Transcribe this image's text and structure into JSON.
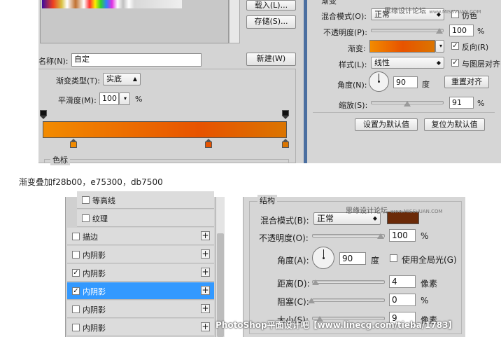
{
  "gradient_editor": {
    "load_btn": "载入(L)...",
    "save_btn": "存储(S)...",
    "name_label": "名称(N):",
    "name_value": "自定",
    "new_btn": "新建(W)",
    "type_label": "渐变类型(T):",
    "type_value": "实底",
    "smooth_label": "平滑度(M):",
    "smooth_value": "100",
    "smooth_unit": "%",
    "color_stops_label": "色标",
    "gradient_colors": [
      "#f28b00",
      "#e75300",
      "#db7500"
    ]
  },
  "gradient_overlay": {
    "section_label": "渐变",
    "blend_label": "混合模式(O):",
    "blend_value": "正常",
    "dither_label": "仿色",
    "opacity_label": "不透明度(P):",
    "opacity_value": "100",
    "opacity_unit": "%",
    "gradient_label": "渐变:",
    "reverse_label": "反向(R)",
    "style_label": "样式(L):",
    "style_value": "线性",
    "align_label": "与图层对齐",
    "angle_label": "角度(N):",
    "angle_value": "90",
    "angle_unit": "度",
    "reset_align_btn": "重置对齐",
    "scale_label": "缩放(S):",
    "scale_value": "91",
    "scale_unit": "%",
    "set_default_btn": "设置为默认值",
    "reset_default_btn": "复位为默认值",
    "watermark": "思缘设计论坛",
    "watermark_url": "www.MISSVUAN.COM"
  },
  "caption": "渐变叠加f28b00，e75300，db7500",
  "styles_list": {
    "items": [
      {
        "label": "等高线",
        "checked": false,
        "selected": false,
        "has_plus": false
      },
      {
        "label": "纹理",
        "checked": false,
        "selected": false,
        "has_plus": false
      },
      {
        "label": "描边",
        "checked": false,
        "selected": false,
        "has_plus": true
      },
      {
        "label": "内阴影",
        "checked": false,
        "selected": false,
        "has_plus": true
      },
      {
        "label": "内阴影",
        "checked": true,
        "selected": false,
        "has_plus": true
      },
      {
        "label": "内阴影",
        "checked": true,
        "selected": true,
        "has_plus": true
      },
      {
        "label": "内阴影",
        "checked": false,
        "selected": false,
        "has_plus": true
      },
      {
        "label": "内阴影",
        "checked": false,
        "selected": false,
        "has_plus": true
      }
    ]
  },
  "inner_shadow": {
    "section_label": "结构",
    "blend_label": "混合模式(B):",
    "blend_value": "正常",
    "color": "#6b2a08",
    "opacity_label": "不透明度(O):",
    "opacity_value": "100",
    "opacity_unit": "%",
    "angle_label": "角度(A):",
    "angle_value": "90",
    "angle_unit": "度",
    "global_light_label": "使用全局光(G)",
    "distance_label": "距离(D):",
    "distance_value": "4",
    "distance_unit": "像素",
    "choke_label": "阻塞(C):",
    "choke_value": "0",
    "choke_unit": "%",
    "size_label": "大小(S):",
    "size_value": "9",
    "size_unit": "像素",
    "watermark": "思缘设计论坛",
    "watermark_url": "www.MISSVUAN.COM",
    "footer_watermark": "PhotoShop平面设计吧【www.linecg.com/tieba/1783】"
  }
}
